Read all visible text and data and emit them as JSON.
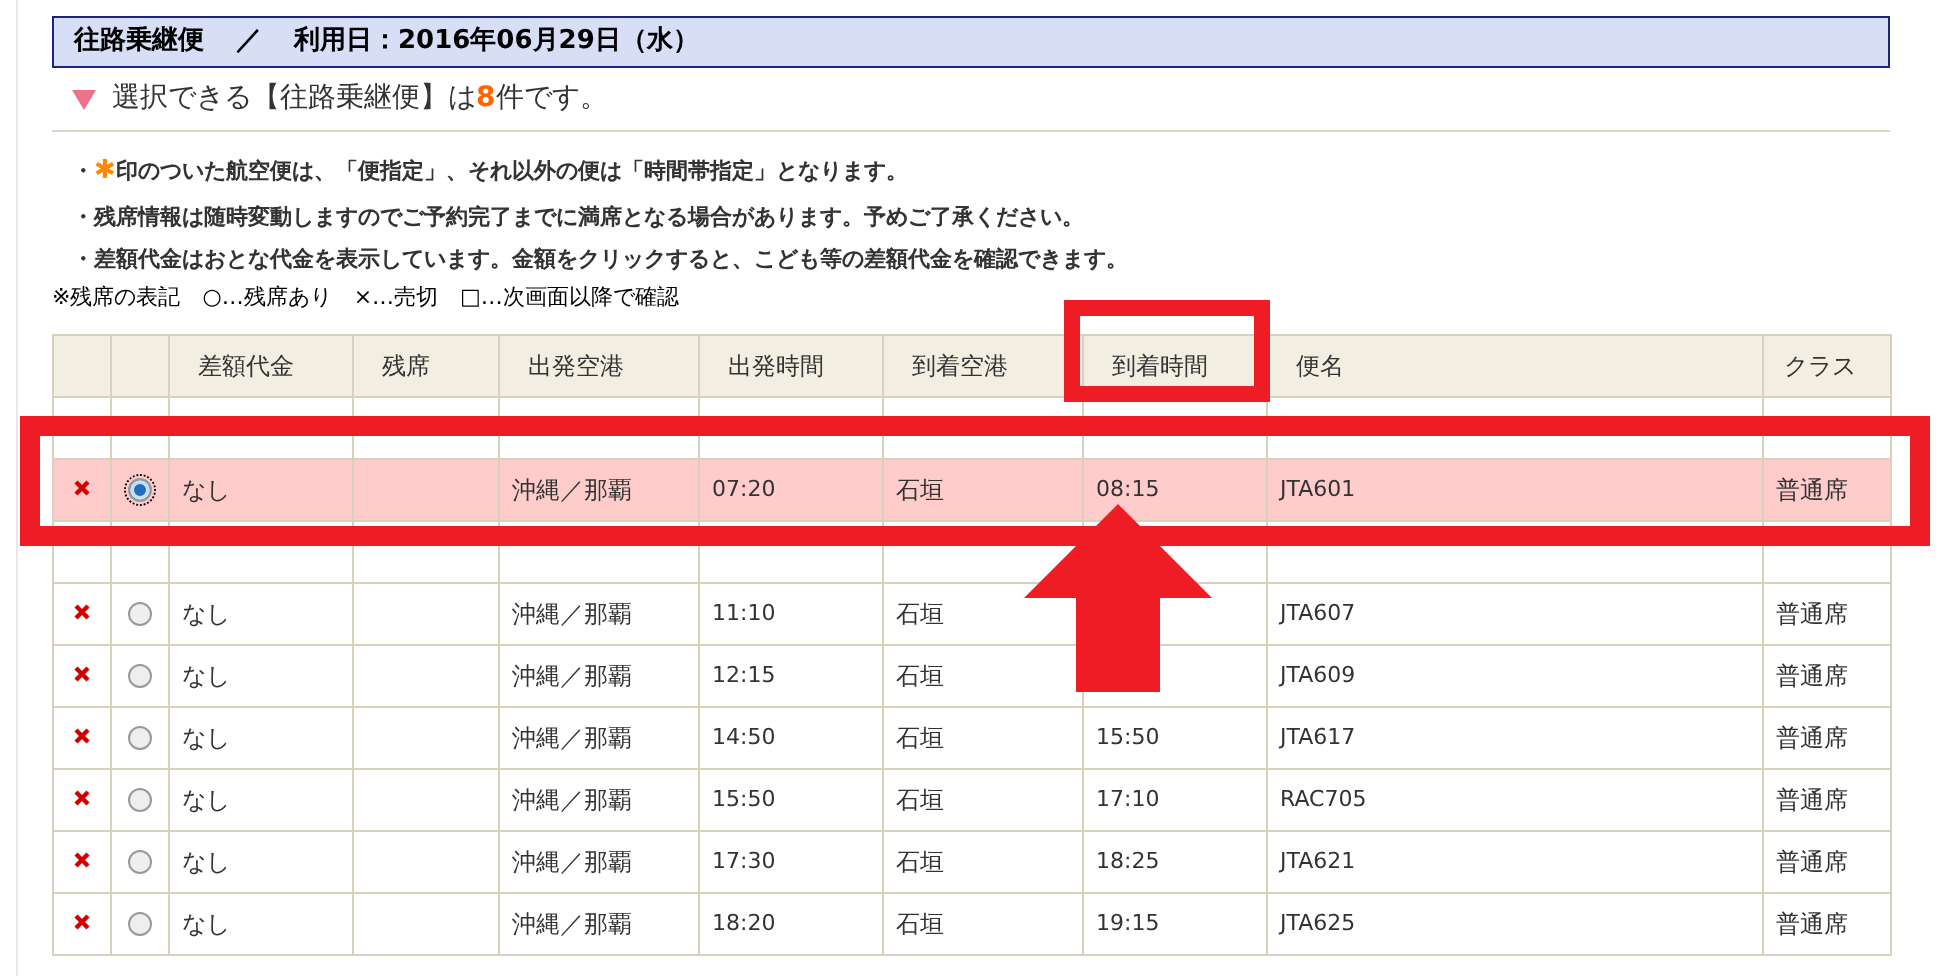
{
  "title_bar": {
    "route": "往路乗継便",
    "separator": "／",
    "date": "利用日：2016年06月29日（水）"
  },
  "heading": {
    "before": "選択できる【往路乗継便】は",
    "count": "8",
    "after": "件です。"
  },
  "notes": [
    {
      "bullet": "・",
      "star": "✱",
      "text": "印のついた航空便は、「便指定」、それ以外の便は「時間帯指定」となります。"
    },
    {
      "bullet": "・",
      "text": "残席情報は随時変動しますのでご予約完了までに満席となる場合があります。予めご了承ください。"
    },
    {
      "bullet": "・",
      "text": "差額代金はおとな代金を表示しています。金額をクリックすると、こども等の差額代金を確認できます。"
    }
  ],
  "legend": "※残席の表記　○…残席あり　×…売切　□…次画面以降で確認",
  "table": {
    "columns": [
      "差額代金",
      "残席",
      "出発空港",
      "出発時間",
      "到着空港",
      "到着時間",
      "便名",
      "クラス"
    ],
    "rows": [
      {
        "kind": "covered"
      },
      {
        "marked": true,
        "selected": true,
        "price": "なし",
        "dep_airport": "沖縄／那覇",
        "dep_time": "07:20",
        "arr_airport": "石垣",
        "arr_time": "08:15",
        "flight": "JTA601",
        "class": "普通席"
      },
      {
        "kind": "covered"
      },
      {
        "marked": true,
        "selected": false,
        "price": "なし",
        "dep_airport": "沖縄／那覇",
        "dep_time": "11:10",
        "arr_airport": "石垣",
        "flight": "JTA607",
        "class": "普通席"
      },
      {
        "marked": true,
        "selected": false,
        "price": "なし",
        "dep_airport": "沖縄／那覇",
        "dep_time": "12:15",
        "arr_airport": "石垣",
        "flight": "JTA609",
        "class": "普通席"
      },
      {
        "marked": true,
        "selected": false,
        "price": "なし",
        "dep_airport": "沖縄／那覇",
        "dep_time": "14:50",
        "arr_airport": "石垣",
        "arr_time": "15:50",
        "flight": "JTA617",
        "class": "普通席"
      },
      {
        "marked": true,
        "selected": false,
        "price": "なし",
        "dep_airport": "沖縄／那覇",
        "dep_time": "15:50",
        "arr_airport": "石垣",
        "arr_time": "17:10",
        "flight": "RAC705",
        "class": "普通席"
      },
      {
        "marked": true,
        "selected": false,
        "price": "なし",
        "dep_airport": "沖縄／那覇",
        "dep_time": "17:30",
        "arr_airport": "石垣",
        "arr_time": "18:25",
        "flight": "JTA621",
        "class": "普通席"
      },
      {
        "marked": true,
        "selected": false,
        "price": "なし",
        "dep_airport": "沖縄／那覇",
        "dep_time": "18:20",
        "arr_airport": "石垣",
        "arr_time": "19:15",
        "flight": "JTA625",
        "class": "普通席"
      }
    ]
  },
  "annotations": [
    {
      "kind": "frame"
    },
    {
      "kind": "frame"
    },
    {
      "kind": "arrow"
    }
  ]
}
